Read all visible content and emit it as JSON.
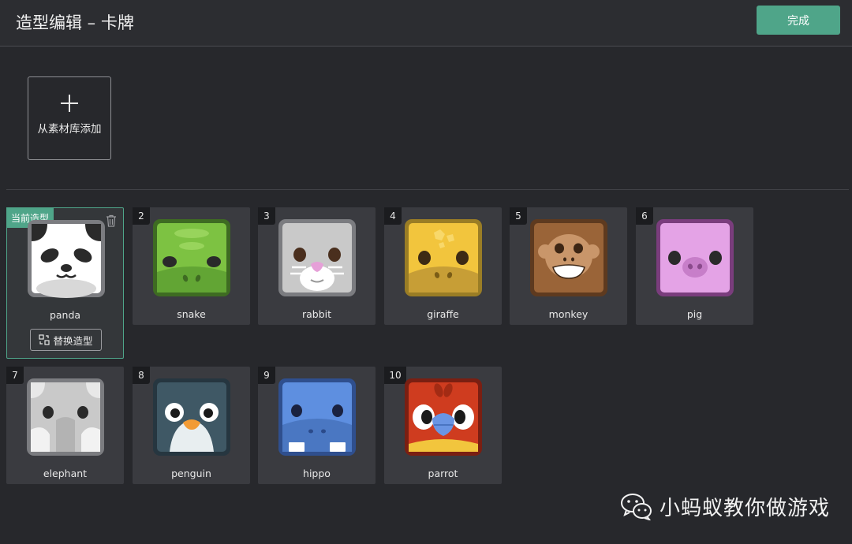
{
  "header": {
    "title": "造型编辑 – 卡牌",
    "done_label": "完成"
  },
  "library": {
    "add_label": "从素材库添加"
  },
  "current": {
    "badge": "当前造型",
    "replace_label": "替换造型"
  },
  "costumes": [
    {
      "index": "",
      "name": "panda"
    },
    {
      "index": "2",
      "name": "snake"
    },
    {
      "index": "3",
      "name": "rabbit"
    },
    {
      "index": "4",
      "name": "giraffe"
    },
    {
      "index": "5",
      "name": "monkey"
    },
    {
      "index": "6",
      "name": "pig"
    },
    {
      "index": "7",
      "name": "elephant"
    },
    {
      "index": "8",
      "name": "penguin"
    },
    {
      "index": "9",
      "name": "hippo"
    },
    {
      "index": "10",
      "name": "parrot"
    }
  ],
  "watermark": {
    "text": "小蚂蚁教你做游戏"
  },
  "colors": {
    "accent": "#4fa589",
    "background": "#27282c",
    "card": "#3a3b40"
  }
}
